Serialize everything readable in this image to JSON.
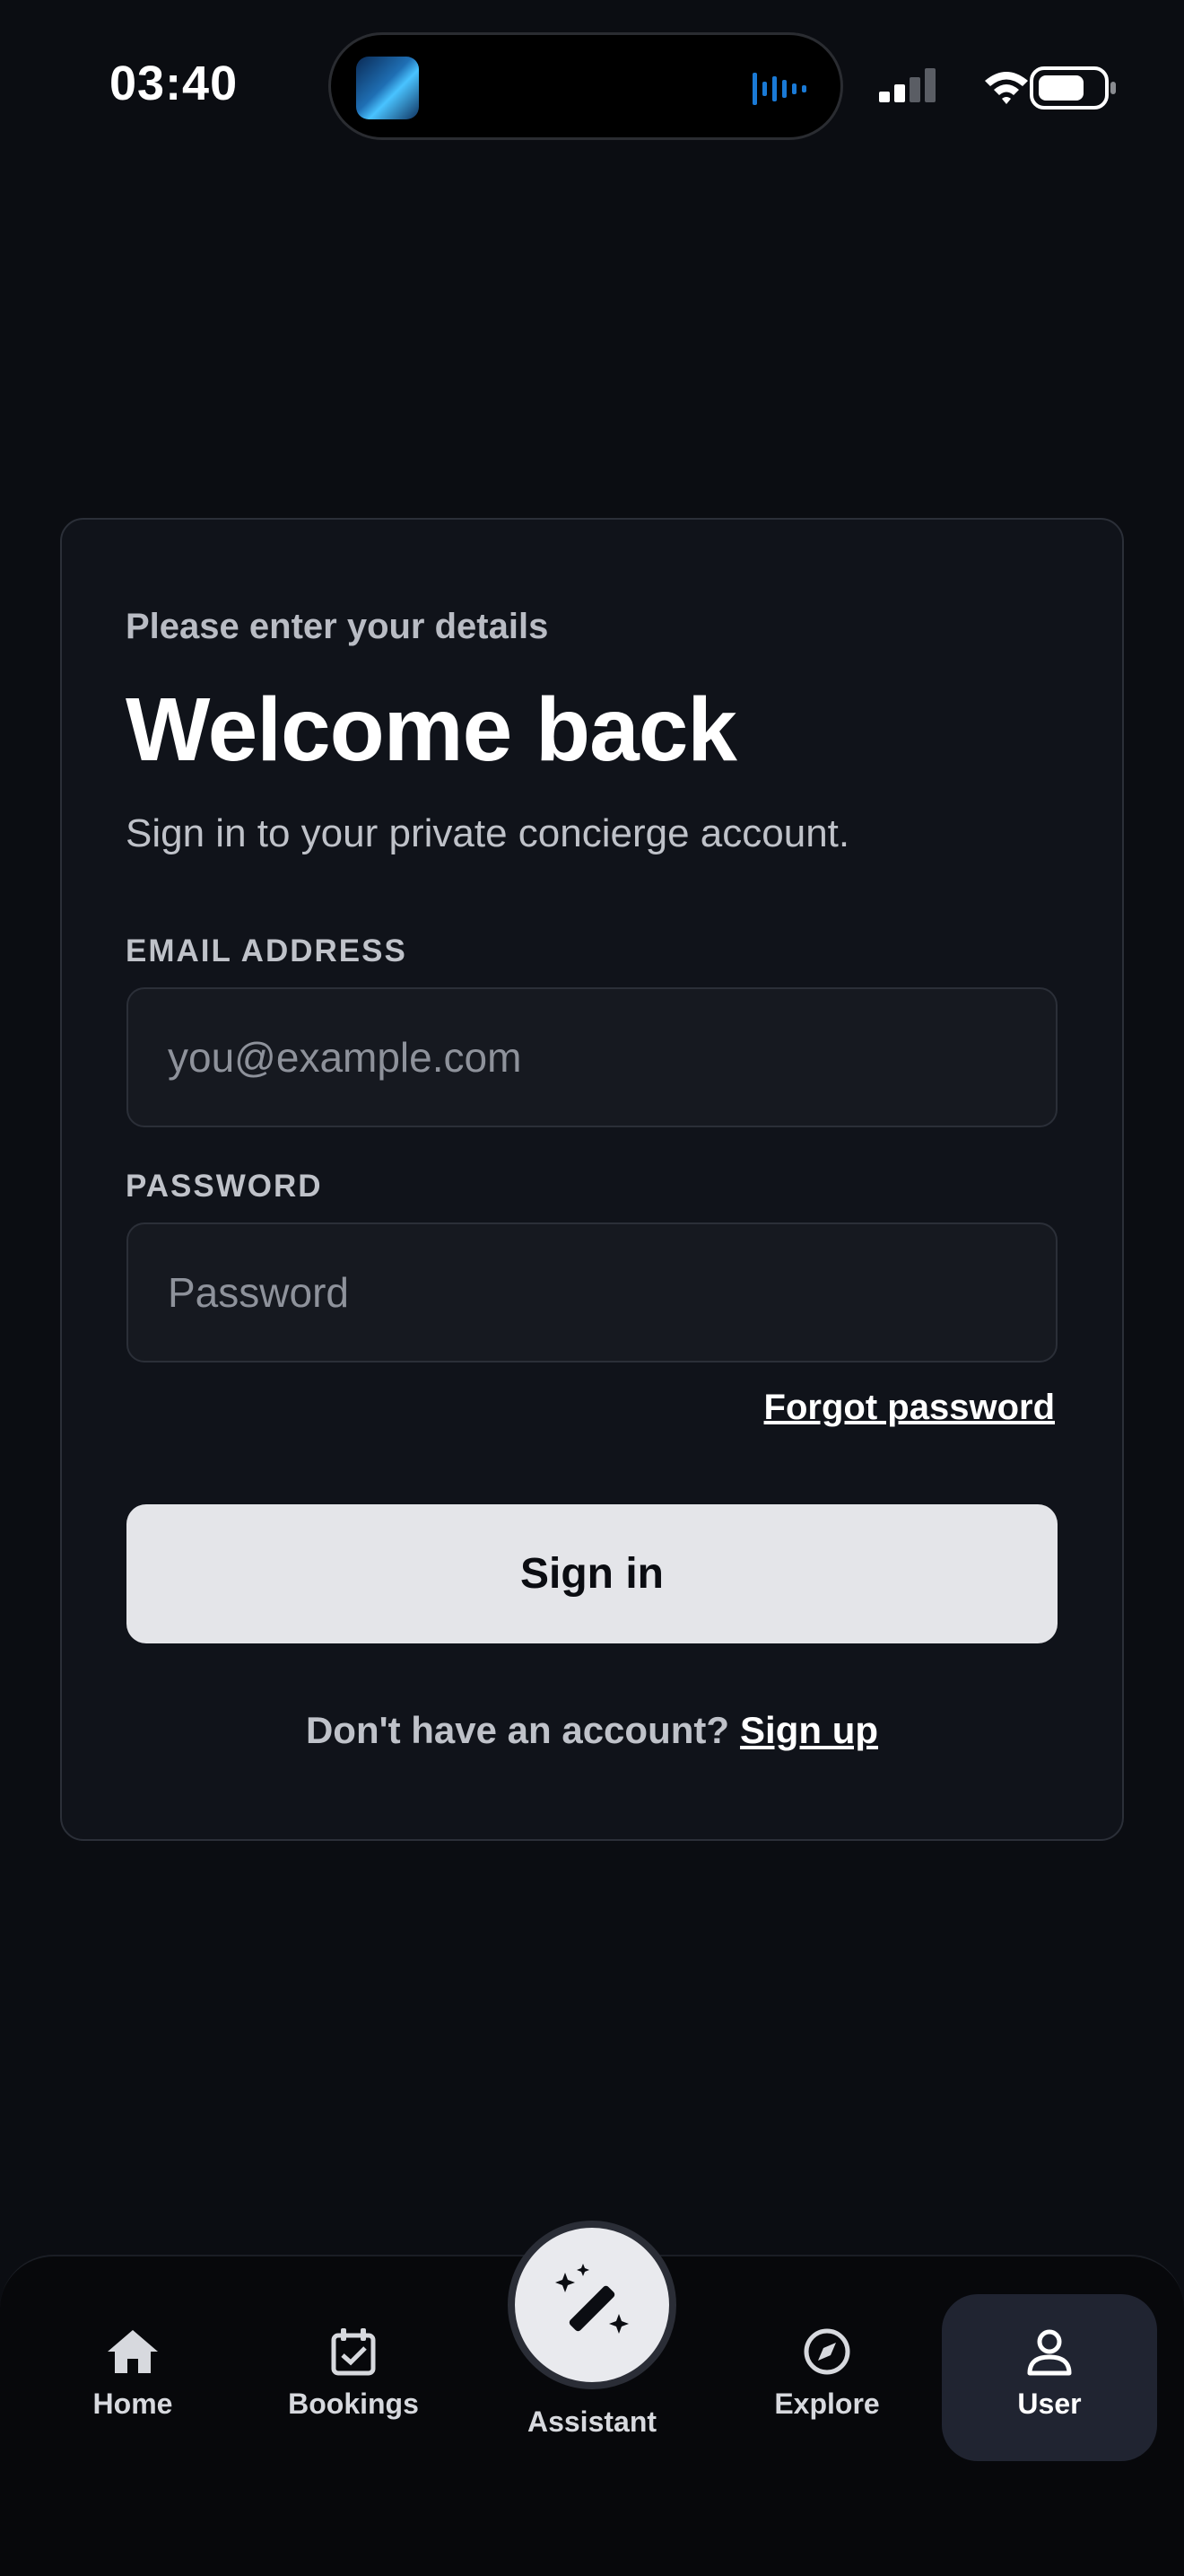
{
  "status_bar": {
    "time": "03:40"
  },
  "login": {
    "subtitle": "Please enter your details",
    "title": "Welcome back",
    "description": "Sign in to your private concierge account.",
    "email_label": "EMAIL ADDRESS",
    "email_placeholder": "you@example.com",
    "email_value": "",
    "password_label": "PASSWORD",
    "password_placeholder": "Password",
    "password_value": "",
    "forgot_label": "Forgot password",
    "signin_label": "Sign in",
    "signup_prompt": "Don't have an account?",
    "signup_label": "Sign up"
  },
  "tabs": [
    {
      "label": "Home",
      "icon": "home-icon"
    },
    {
      "label": "Bookings",
      "icon": "calendar-check-icon"
    },
    {
      "label": "Assistant",
      "icon": "magic-wand-icon"
    },
    {
      "label": "Explore",
      "icon": "compass-icon"
    },
    {
      "label": "User",
      "icon": "user-icon",
      "active": true
    }
  ],
  "colors": {
    "background": "#0b0d12",
    "card": "#10131a",
    "primary_button": "#e4e5e9",
    "active_tab": "#202431"
  }
}
